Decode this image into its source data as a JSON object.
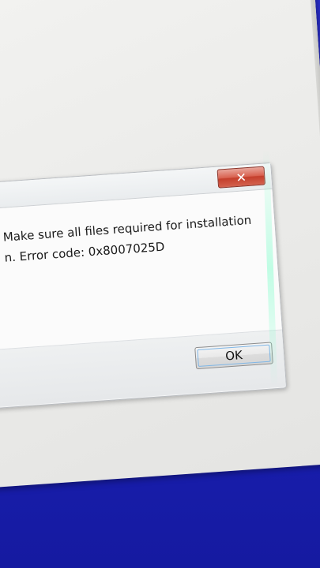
{
  "dialog": {
    "close_glyph": "✕",
    "message_line1": "Make sure all files required for installation",
    "message_line2": "n. Error code: 0x8007025D",
    "ok_label": "OK"
  },
  "colors": {
    "installer_background": "#1b20b6",
    "close_button": "#d8614f"
  }
}
